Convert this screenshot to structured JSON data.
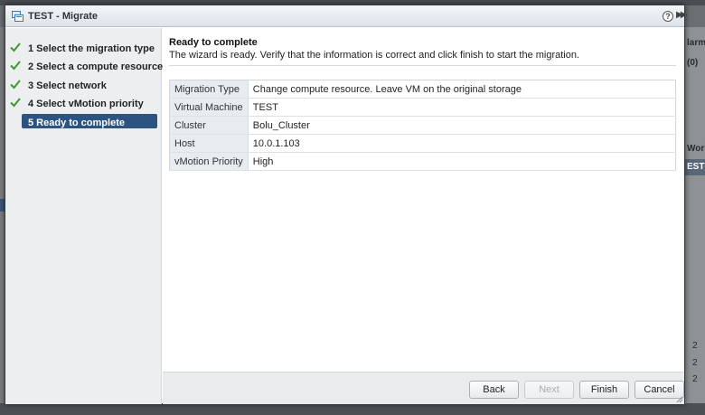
{
  "window": {
    "title": "TEST - Migrate",
    "help_glyph": "?",
    "expand_glyph": "▶▶"
  },
  "background": {
    "right_labels": [
      "larm",
      "(0)",
      "Work",
      "EST",
      "2",
      "2",
      "2"
    ]
  },
  "steps": [
    {
      "label": "1  Select the migration type",
      "done": true
    },
    {
      "label": "2  Select a compute resource",
      "done": true
    },
    {
      "label": "3  Select network",
      "done": true
    },
    {
      "label": "4  Select vMotion priority",
      "done": true
    },
    {
      "label": "5  Ready to complete",
      "done": false,
      "active": true
    }
  ],
  "content": {
    "title": "Ready to complete",
    "description": "The wizard is ready. Verify that the information is correct and click finish to start the migration.",
    "rows": [
      {
        "key": "Migration Type",
        "value": "Change compute resource. Leave VM on the original storage"
      },
      {
        "key": "Virtual Machine",
        "value": "TEST"
      },
      {
        "key": "Cluster",
        "value": "Bolu_Cluster"
      },
      {
        "key": "Host",
        "value": "10.0.1.103"
      },
      {
        "key": "vMotion Priority",
        "value": "High"
      }
    ]
  },
  "footer": {
    "back": "Back",
    "next": "Next",
    "finish": "Finish",
    "cancel": "Cancel"
  },
  "colors": {
    "active_step": "#2d5480",
    "check": "#3c9a2c",
    "key_cell": "#e7ecf1"
  },
  "icons": {
    "title": "vm-migrate-icon",
    "check": "check-icon",
    "help": "help-icon",
    "expand": "double-chevron-right-icon"
  }
}
